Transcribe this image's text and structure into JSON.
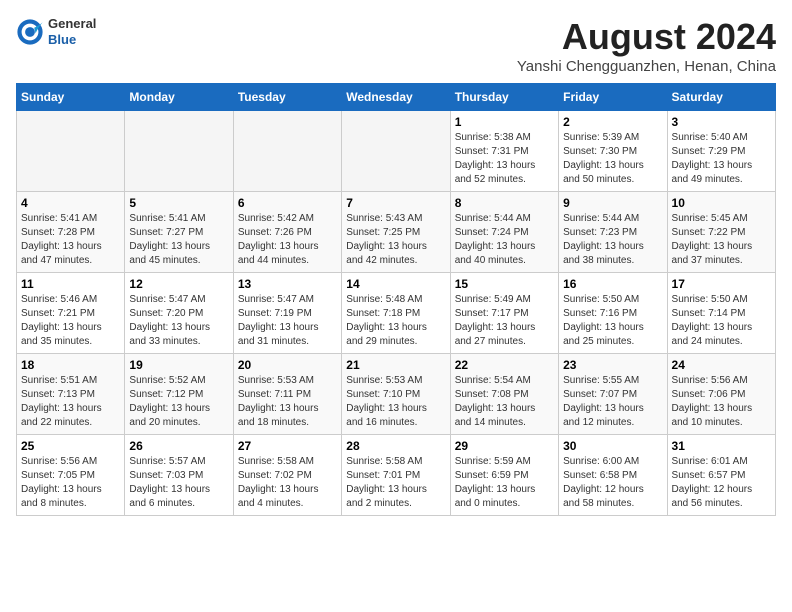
{
  "header": {
    "logo_general": "General",
    "logo_blue": "Blue",
    "month_year": "August 2024",
    "location": "Yanshi Chengguanzhen, Henan, China"
  },
  "weekdays": [
    "Sunday",
    "Monday",
    "Tuesday",
    "Wednesday",
    "Thursday",
    "Friday",
    "Saturday"
  ],
  "weeks": [
    [
      {
        "day": "",
        "info": ""
      },
      {
        "day": "",
        "info": ""
      },
      {
        "day": "",
        "info": ""
      },
      {
        "day": "",
        "info": ""
      },
      {
        "day": "1",
        "info": "Sunrise: 5:38 AM\nSunset: 7:31 PM\nDaylight: 13 hours\nand 52 minutes."
      },
      {
        "day": "2",
        "info": "Sunrise: 5:39 AM\nSunset: 7:30 PM\nDaylight: 13 hours\nand 50 minutes."
      },
      {
        "day": "3",
        "info": "Sunrise: 5:40 AM\nSunset: 7:29 PM\nDaylight: 13 hours\nand 49 minutes."
      }
    ],
    [
      {
        "day": "4",
        "info": "Sunrise: 5:41 AM\nSunset: 7:28 PM\nDaylight: 13 hours\nand 47 minutes."
      },
      {
        "day": "5",
        "info": "Sunrise: 5:41 AM\nSunset: 7:27 PM\nDaylight: 13 hours\nand 45 minutes."
      },
      {
        "day": "6",
        "info": "Sunrise: 5:42 AM\nSunset: 7:26 PM\nDaylight: 13 hours\nand 44 minutes."
      },
      {
        "day": "7",
        "info": "Sunrise: 5:43 AM\nSunset: 7:25 PM\nDaylight: 13 hours\nand 42 minutes."
      },
      {
        "day": "8",
        "info": "Sunrise: 5:44 AM\nSunset: 7:24 PM\nDaylight: 13 hours\nand 40 minutes."
      },
      {
        "day": "9",
        "info": "Sunrise: 5:44 AM\nSunset: 7:23 PM\nDaylight: 13 hours\nand 38 minutes."
      },
      {
        "day": "10",
        "info": "Sunrise: 5:45 AM\nSunset: 7:22 PM\nDaylight: 13 hours\nand 37 minutes."
      }
    ],
    [
      {
        "day": "11",
        "info": "Sunrise: 5:46 AM\nSunset: 7:21 PM\nDaylight: 13 hours\nand 35 minutes."
      },
      {
        "day": "12",
        "info": "Sunrise: 5:47 AM\nSunset: 7:20 PM\nDaylight: 13 hours\nand 33 minutes."
      },
      {
        "day": "13",
        "info": "Sunrise: 5:47 AM\nSunset: 7:19 PM\nDaylight: 13 hours\nand 31 minutes."
      },
      {
        "day": "14",
        "info": "Sunrise: 5:48 AM\nSunset: 7:18 PM\nDaylight: 13 hours\nand 29 minutes."
      },
      {
        "day": "15",
        "info": "Sunrise: 5:49 AM\nSunset: 7:17 PM\nDaylight: 13 hours\nand 27 minutes."
      },
      {
        "day": "16",
        "info": "Sunrise: 5:50 AM\nSunset: 7:16 PM\nDaylight: 13 hours\nand 25 minutes."
      },
      {
        "day": "17",
        "info": "Sunrise: 5:50 AM\nSunset: 7:14 PM\nDaylight: 13 hours\nand 24 minutes."
      }
    ],
    [
      {
        "day": "18",
        "info": "Sunrise: 5:51 AM\nSunset: 7:13 PM\nDaylight: 13 hours\nand 22 minutes."
      },
      {
        "day": "19",
        "info": "Sunrise: 5:52 AM\nSunset: 7:12 PM\nDaylight: 13 hours\nand 20 minutes."
      },
      {
        "day": "20",
        "info": "Sunrise: 5:53 AM\nSunset: 7:11 PM\nDaylight: 13 hours\nand 18 minutes."
      },
      {
        "day": "21",
        "info": "Sunrise: 5:53 AM\nSunset: 7:10 PM\nDaylight: 13 hours\nand 16 minutes."
      },
      {
        "day": "22",
        "info": "Sunrise: 5:54 AM\nSunset: 7:08 PM\nDaylight: 13 hours\nand 14 minutes."
      },
      {
        "day": "23",
        "info": "Sunrise: 5:55 AM\nSunset: 7:07 PM\nDaylight: 13 hours\nand 12 minutes."
      },
      {
        "day": "24",
        "info": "Sunrise: 5:56 AM\nSunset: 7:06 PM\nDaylight: 13 hours\nand 10 minutes."
      }
    ],
    [
      {
        "day": "25",
        "info": "Sunrise: 5:56 AM\nSunset: 7:05 PM\nDaylight: 13 hours\nand 8 minutes."
      },
      {
        "day": "26",
        "info": "Sunrise: 5:57 AM\nSunset: 7:03 PM\nDaylight: 13 hours\nand 6 minutes."
      },
      {
        "day": "27",
        "info": "Sunrise: 5:58 AM\nSunset: 7:02 PM\nDaylight: 13 hours\nand 4 minutes."
      },
      {
        "day": "28",
        "info": "Sunrise: 5:58 AM\nSunset: 7:01 PM\nDaylight: 13 hours\nand 2 minutes."
      },
      {
        "day": "29",
        "info": "Sunrise: 5:59 AM\nSunset: 6:59 PM\nDaylight: 13 hours\nand 0 minutes."
      },
      {
        "day": "30",
        "info": "Sunrise: 6:00 AM\nSunset: 6:58 PM\nDaylight: 12 hours\nand 58 minutes."
      },
      {
        "day": "31",
        "info": "Sunrise: 6:01 AM\nSunset: 6:57 PM\nDaylight: 12 hours\nand 56 minutes."
      }
    ]
  ]
}
